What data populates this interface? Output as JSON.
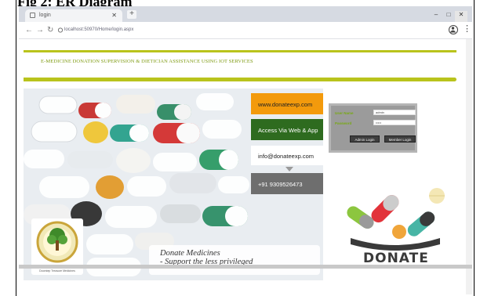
{
  "document": {
    "caption": "Fig 2: ER Diagram"
  },
  "browser": {
    "tab_title": "login",
    "address": "localhost:50970/Home/login.aspx",
    "profile_initial": "P"
  },
  "site": {
    "title": "E-MEDICINE DONATION SUPERVISION & DIETICIAN ASSISTANCE USING IOT SERVICES"
  },
  "hero": {
    "website": "www.donateexp.com",
    "access": "Access Via Web & App",
    "email": "info@donateexp.com",
    "phone": "+91 9309526473",
    "logo_caption": "Doorstep Treasure Medicines",
    "tagline_line1": "Donate Medicines",
    "tagline_line2": "- Support the less privileged"
  },
  "login": {
    "username_label": "User Name",
    "username_value": "admin",
    "password_label": "Password",
    "password_value": "•••••",
    "admin_button": "Admin Login",
    "member_button": "Member Login"
  },
  "donate": {
    "label": "DONATE"
  },
  "colors": {
    "accent": "#b9c31c",
    "title_green": "#7d9a10",
    "orange": "#f39a0c",
    "dark_green": "#2e6b1f",
    "gray": "#6e6e6e"
  }
}
